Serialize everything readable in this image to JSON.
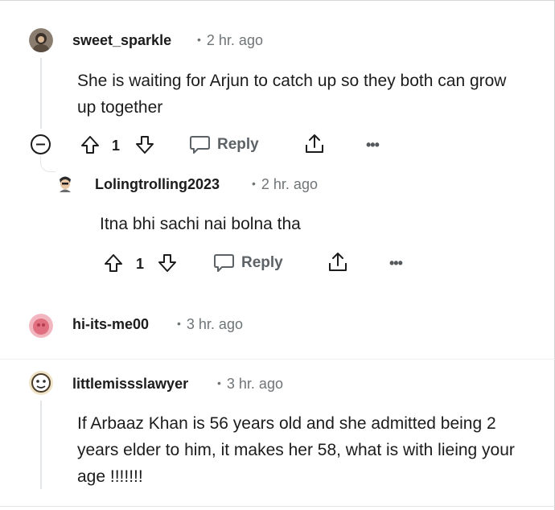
{
  "comments": [
    {
      "username": "sweet_sparkle",
      "time": "2 hr. ago",
      "text": "She is waiting for Arjun to catch up so they both can grow up together",
      "votes": "1",
      "reply_label": "Reply"
    },
    {
      "username": "Lolingtrolling2023",
      "time": "2 hr. ago",
      "text": "Itna bhi sachi nai bolna tha",
      "votes": "1",
      "reply_label": "Reply"
    },
    {
      "username": "hi-its-me00",
      "time": "3 hr. ago"
    },
    {
      "username": "littlemissslawyer",
      "time": "3 hr. ago",
      "text": "If Arbaaz Khan is 56 years old and she admitted being 2 years elder to him, it makes her 58, what is with lieing your age !!!!!!!"
    }
  ],
  "more_label": "•••",
  "dot": "•",
  "colors": {
    "text": "#1c1c1c",
    "meta": "#6f7477",
    "thread_line": "#e3e6e8",
    "action_gray": "#5c6266"
  },
  "icons": [
    "collapse-icon",
    "upvote-icon",
    "downvote-icon",
    "reply-icon",
    "share-icon",
    "more-icon"
  ]
}
